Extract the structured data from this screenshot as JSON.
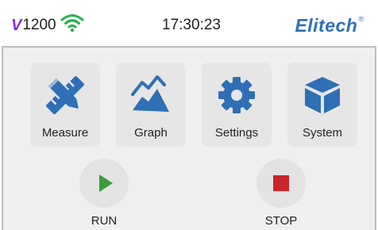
{
  "status_bar": {
    "model_mark": "V",
    "model_number": "1200",
    "time": "17:30:23",
    "brand": "Elitech",
    "brand_mark": "®",
    "wifi_icon": "wifi-icon"
  },
  "menu": {
    "tiles": [
      {
        "label": "Measure",
        "icon": "ruler-pencil-icon"
      },
      {
        "label": "Graph",
        "icon": "line-graph-icon"
      },
      {
        "label": "Settings",
        "icon": "gear-icon"
      },
      {
        "label": "System",
        "icon": "cube-icon"
      }
    ]
  },
  "controls": {
    "run_label": "RUN",
    "stop_label": "STOP"
  },
  "colors": {
    "icon_blue": "#2f6fb6",
    "run_green": "#3c9a3f",
    "stop_red": "#c8252a",
    "wifi_green": "#22b14c",
    "model_purple": "#8a2be2"
  }
}
